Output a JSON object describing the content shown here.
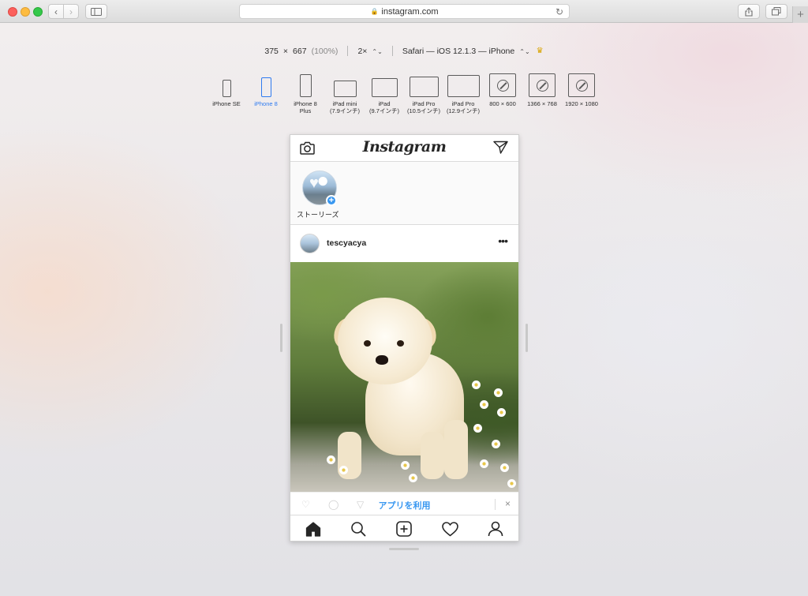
{
  "browser": {
    "address": "instagram.com",
    "new_tab_symbol": "+"
  },
  "responsive": {
    "width": "375",
    "times": "×",
    "height": "667",
    "zoom": "(100%)",
    "scale": "2×",
    "user_agent": "Safari — iOS 12.1.3 — iPhone",
    "devices": [
      {
        "line1": "iPhone SE",
        "line2": ""
      },
      {
        "line1": "iPhone 8",
        "line2": ""
      },
      {
        "line1": "iPhone 8",
        "line2": "Plus"
      },
      {
        "line1": "iPad mini",
        "line2": "(7.9インチ)"
      },
      {
        "line1": "iPad",
        "line2": "(9.7インチ)"
      },
      {
        "line1": "iPad Pro",
        "line2": "(10.5インチ)"
      },
      {
        "line1": "iPad Pro",
        "line2": "(12.9インチ)"
      },
      {
        "line1": "800 × 600",
        "line2": ""
      },
      {
        "line1": "1366 × 768",
        "line2": ""
      },
      {
        "line1": "1920 × 1080",
        "line2": ""
      }
    ],
    "active_device": "iPhone 8"
  },
  "instagram": {
    "logo": "Instagram",
    "stories_label": "ストーリーズ",
    "post_username": "tescyacya",
    "more_symbol": "•••",
    "app_banner": "アプリを利用",
    "close_symbol": "×"
  },
  "colors": {
    "accent": "#3897f0",
    "active_device": "#2f7bf0"
  }
}
